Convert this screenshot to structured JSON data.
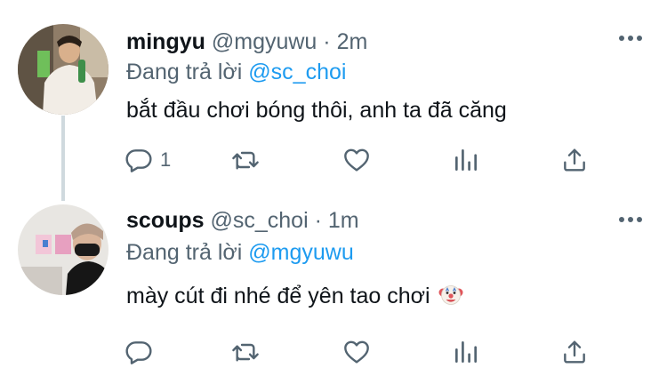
{
  "tweets": [
    {
      "name": "mingyu",
      "handle": "@mgyuwu",
      "separator": "·",
      "time": "2m",
      "reply_prefix": "Đang trả lời",
      "reply_to": "@sc_choi",
      "text": "bắt đầu chơi bóng thôi, anh ta đã căng",
      "reply_count": "1"
    },
    {
      "name": "scoups",
      "handle": "@sc_choi",
      "separator": "·",
      "time": "1m",
      "reply_prefix": "Đang trả lời",
      "reply_to": "@mgyuwu",
      "text": "mày cút đi nhé để yên tao chơi",
      "emoji": "clown-face-emoji"
    }
  ],
  "colors": {
    "text_primary": "#0f1419",
    "text_secondary": "#536471",
    "link": "#1d9bf0",
    "thread_line": "#cfd9de"
  },
  "icons": [
    "reply-icon",
    "retweet-icon",
    "like-icon",
    "views-icon",
    "share-icon",
    "more-icon"
  ]
}
